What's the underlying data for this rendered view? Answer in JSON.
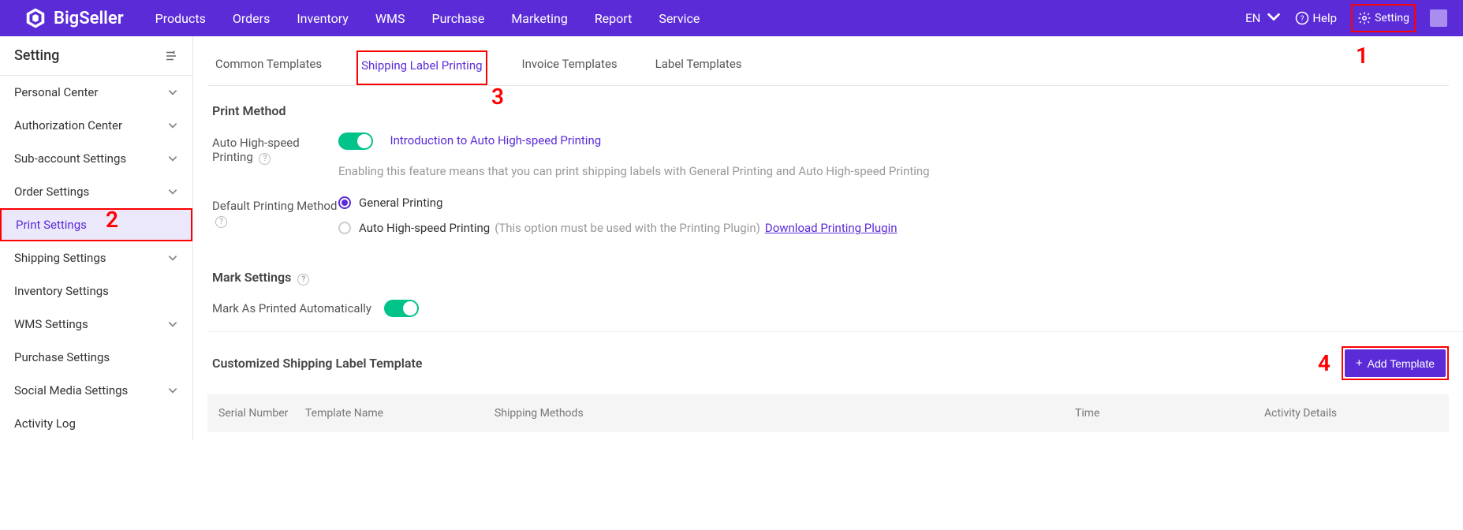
{
  "topnav": {
    "brand": "BigSeller",
    "items": [
      "Products",
      "Orders",
      "Inventory",
      "WMS",
      "Purchase",
      "Marketing",
      "Report",
      "Service"
    ],
    "lang": "EN",
    "help": "Help",
    "setting": "Setting"
  },
  "annotations": {
    "n1": "1",
    "n2": "2",
    "n3": "3",
    "n4": "4"
  },
  "sidebar": {
    "title": "Setting",
    "items": [
      {
        "label": "Personal Center",
        "expandable": true
      },
      {
        "label": "Authorization Center",
        "expandable": true
      },
      {
        "label": "Sub-account Settings",
        "expandable": true
      },
      {
        "label": "Order Settings",
        "expandable": true
      },
      {
        "label": "Print Settings",
        "expandable": false,
        "active": true
      },
      {
        "label": "Shipping Settings",
        "expandable": true
      },
      {
        "label": "Inventory Settings",
        "expandable": false
      },
      {
        "label": "WMS Settings",
        "expandable": true
      },
      {
        "label": "Purchase Settings",
        "expandable": false
      },
      {
        "label": "Social Media Settings",
        "expandable": true
      },
      {
        "label": "Activity Log",
        "expandable": false
      }
    ]
  },
  "tabs": [
    "Common Templates",
    "Shipping Label Printing",
    "Invoice Templates",
    "Label Templates"
  ],
  "print_method": {
    "title": "Print Method",
    "auto_label": "Auto High-speed Printing",
    "intro_link": "Introduction to Auto High-speed Printing",
    "auto_desc": "Enabling this feature means that you can print shipping labels with General Printing and Auto High-speed Printing",
    "default_label": "Default Printing Method",
    "opt_general": "General Printing",
    "opt_auto": "Auto High-speed Printing",
    "opt_auto_hint": "(This option must be used with the Printing Plugin)",
    "dl_link": "Download Printing Plugin"
  },
  "mark": {
    "title": "Mark Settings",
    "auto_label": "Mark As Printed Automatically"
  },
  "custom": {
    "title": "Customized Shipping Label Template",
    "add_btn": "Add Template",
    "cols": {
      "serial": "Serial Number",
      "name": "Template Name",
      "methods": "Shipping Methods",
      "time": "Time",
      "details": "Activity Details"
    }
  }
}
